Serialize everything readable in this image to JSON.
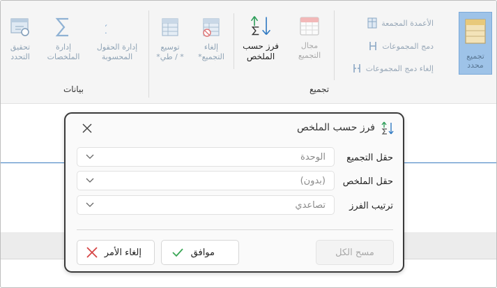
{
  "ribbon": {
    "groups": {
      "data_label": "بيانات",
      "group_label": "تجميع"
    },
    "buttons": {
      "check_data": "تحقيق\nالتحدد",
      "manage_aggregates": "إدارة\nالملخصات",
      "manage_calc_fields": "إدارة الحقول\nالمحسوبة",
      "expand_all": "توسيع\n* / طي*",
      "ungroup_sel": "إلغاء\nالتجميع*",
      "sort_by_summary": "فرز حسب\nالملخص",
      "group_range": "مجال\nالتجميع"
    },
    "small_items": [
      {
        "label": "الأعمدة المجمعة"
      },
      {
        "label": "دمج المجموعات"
      },
      {
        "label": "إلغاء دمج المجموعات"
      }
    ],
    "selected_large": {
      "label": "تجميع\nمحدد"
    }
  },
  "dialog": {
    "title": "فرز حسب الملخص",
    "fields": [
      {
        "label": "حقل التجميع",
        "value": "الوحدة"
      },
      {
        "label": "حقل الملخص",
        "value": "(بدون)"
      },
      {
        "label": "ترتيب الفرز",
        "value": "تصاعدي"
      }
    ],
    "buttons": {
      "clear_all": "مسح الكل",
      "ok": "موافق",
      "cancel": "إلغاء الأمر"
    }
  },
  "colors": {
    "accent_blue": "#5b9bd5",
    "ok_green": "#3aa655",
    "cancel_red": "#d64545"
  }
}
